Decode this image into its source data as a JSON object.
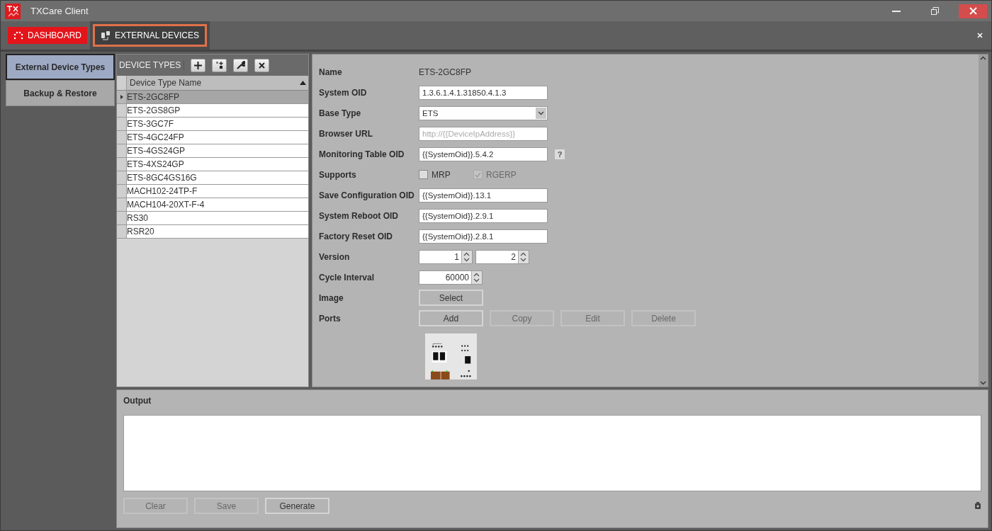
{
  "window": {
    "title": "TXCare Client"
  },
  "tabs": [
    {
      "label": "DASHBOARD",
      "kind": "dashboard",
      "selected": false
    },
    {
      "label": "EXTERNAL DEVICES",
      "kind": "devices",
      "selected": true
    }
  ],
  "sidebar": {
    "items": [
      {
        "label": "External Device Types",
        "selected": true
      },
      {
        "label": "Backup & Restore",
        "selected": false
      }
    ]
  },
  "device_types": {
    "title": "DEVICE TYPES",
    "column": "Device Type Name",
    "rows": [
      {
        "name": "ETS-2GC8FP",
        "selected": true
      },
      {
        "name": "ETS-2GS8GP",
        "selected": false
      },
      {
        "name": "ETS-3GC7F",
        "selected": false
      },
      {
        "name": "ETS-4GC24FP",
        "selected": false
      },
      {
        "name": "ETS-4GS24GP",
        "selected": false
      },
      {
        "name": "ETS-4XS24GP",
        "selected": false
      },
      {
        "name": "ETS-8GC4GS16G",
        "selected": false
      },
      {
        "name": "MACH102-24TP-F",
        "selected": false
      },
      {
        "name": "MACH104-20XT-F-4",
        "selected": false
      },
      {
        "name": "RS30",
        "selected": false
      },
      {
        "name": "RSR20",
        "selected": false
      }
    ]
  },
  "details": {
    "fields": [
      {
        "kind": "text",
        "label": "Name",
        "value": "ETS-2GC8FP"
      },
      {
        "kind": "input",
        "label": "System OID",
        "value": "1.3.6.1.4.1.31850.4.1.3"
      },
      {
        "kind": "select",
        "label": "Base Type",
        "value": "ETS"
      },
      {
        "kind": "input",
        "label": "Browser URL",
        "placeholder": "http://{{DeviceIpAddress}}"
      },
      {
        "kind": "input",
        "label": "Monitoring Table OID",
        "value": "{{SystemOid}}.5.4.2",
        "help": "?"
      },
      {
        "kind": "checks",
        "label": "Supports",
        "options": [
          {
            "label": "MRP",
            "checked": false,
            "disabled": false
          },
          {
            "label": "RGERP",
            "checked": true,
            "disabled": true
          }
        ]
      },
      {
        "kind": "input",
        "label": "Save Configuration OID",
        "value": "{{SystemOid}}.13.1"
      },
      {
        "kind": "input",
        "label": "System Reboot OID",
        "value": "{{SystemOid}}.2.9.1"
      },
      {
        "kind": "input",
        "label": "Factory Reset OID",
        "value": "{{SystemOid}}.2.8.1"
      },
      {
        "kind": "spinners",
        "label": "Version",
        "values": [
          "1",
          "2"
        ]
      },
      {
        "kind": "spinners",
        "label": "Cycle Interval",
        "values": [
          "60000"
        ]
      },
      {
        "kind": "buttons",
        "label": "Image",
        "buttons": [
          {
            "label": "Select",
            "disabled": false
          }
        ]
      },
      {
        "kind": "buttons",
        "label": "Ports",
        "buttons": [
          {
            "label": "Add",
            "disabled": false
          },
          {
            "label": "Copy",
            "disabled": true
          },
          {
            "label": "Edit",
            "disabled": true
          },
          {
            "label": "Delete",
            "disabled": true
          }
        ]
      }
    ]
  },
  "output": {
    "title": "Output",
    "buttons": [
      {
        "label": "Clear",
        "disabled": true
      },
      {
        "label": "Save",
        "disabled": true
      },
      {
        "label": "Generate",
        "disabled": false
      }
    ]
  }
}
